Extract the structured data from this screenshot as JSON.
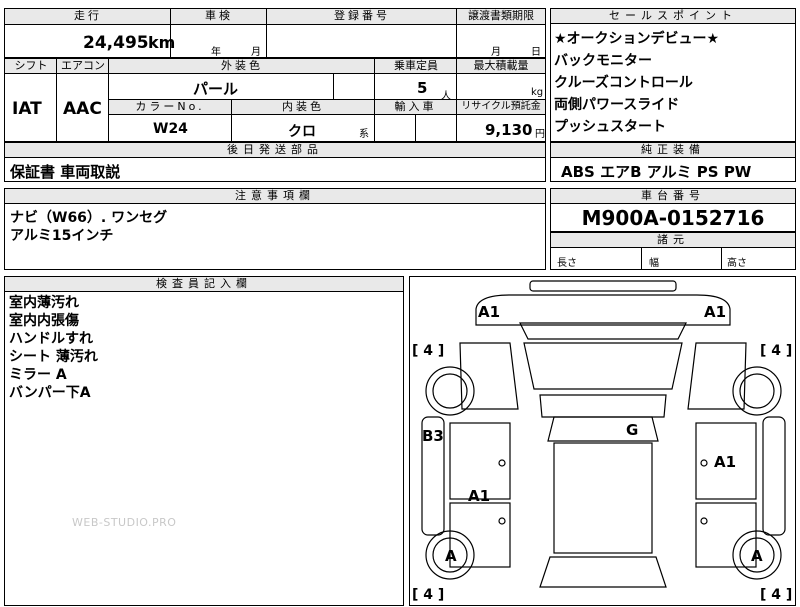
{
  "header": {
    "mileage_label": "走行",
    "shaken_label": "車検",
    "reg_no_label": "登録番号",
    "transfer_deadline_label": "譲渡書類期限",
    "mileage_value": "24,495",
    "mileage_unit": "km",
    "year_unit": "年",
    "month_unit": "月",
    "day_unit": "日"
  },
  "specs": {
    "shift_label": "シフト",
    "aircon_label": "エアコン",
    "exterior_label": "外装色",
    "capacity_label": "乗車定員",
    "max_load_label": "最大積載量",
    "shift_value": "IAT",
    "aircon_value": "AAC",
    "exterior_value": "パール",
    "capacity_value": "5",
    "capacity_unit": "人",
    "load_unit": "kg",
    "color_no_label": "カラーNo.",
    "interior_label": "内装色",
    "import_label": "輸入車",
    "recycle_label": "リサイクル預託金",
    "color_no_value": "W24",
    "interior_value": "クロ",
    "interior_suffix": "系",
    "recycle_value": "9,130",
    "recycle_unit": "円"
  },
  "later_parts": {
    "label": "後日発送部品",
    "value": "保証書 車両取説"
  },
  "notes": {
    "label": "注意事項欄",
    "lines": [
      "ナビ（W66）. ワンセグ",
      "アルミ15インチ"
    ]
  },
  "sales_points": {
    "label": "セールスポイント",
    "items": [
      "★オークションデビュー★",
      "バックモニター",
      "クルーズコントロール",
      "両側パワースライド",
      "プッシュスタート"
    ]
  },
  "equipment": {
    "label": "純正装備",
    "value": "ABS エアB アルミ PS PW"
  },
  "chassis": {
    "label": "車台番号",
    "value": "M900A-0152716"
  },
  "dimensions": {
    "label": "諸元",
    "length_label": "長さ",
    "width_label": "幅",
    "height_label": "高さ"
  },
  "inspector": {
    "label": "検査員記入欄",
    "lines": [
      "室内薄汚れ",
      "室内内張傷",
      "ハンドルすれ",
      "シート 薄汚れ",
      "ミラー A",
      "バンパー下A"
    ]
  },
  "diagram": {
    "marks": {
      "front_left": "A1",
      "front_right": "A1",
      "left_rear_door": "B3",
      "roof": "G",
      "right_door": "A1",
      "left_door": "A1",
      "rear_left_wheel": "A",
      "rear_right_wheel": "A"
    },
    "tire_labels": {
      "front_left": "[ 4 ]",
      "front_right": "[ 4 ]",
      "rear_left": "[ 4 ]",
      "rear_right": "[ 4 ]"
    }
  },
  "watermark": "WEB-STUDIO.PRO"
}
